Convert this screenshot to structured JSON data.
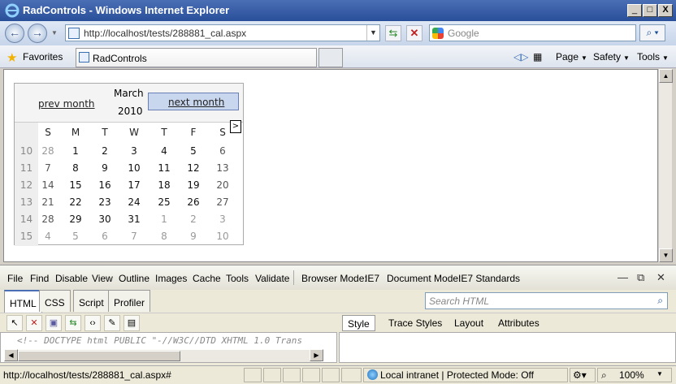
{
  "window": {
    "title": "RadControls - Windows Internet Explorer",
    "minimize": "_",
    "maximize": "□",
    "close": "X"
  },
  "addressbar": {
    "url": "http://localhost/tests/288881_cal.aspx",
    "search_placeholder": "Google"
  },
  "favorites": {
    "label": "Favorites",
    "tab_title": "RadControls"
  },
  "commandbar": {
    "page": "Page",
    "safety": "Safety",
    "tools": "Tools"
  },
  "calendar": {
    "prev_label": "prev month",
    "next_label": "next month",
    "month": "March",
    "year": "2010",
    "tooltip_char": ">",
    "day_headers": [
      "S",
      "M",
      "T",
      "W",
      "T",
      "F",
      "S"
    ],
    "weeks": [
      {
        "num": "10",
        "days": [
          "28",
          "1",
          "2",
          "3",
          "4",
          "5",
          "6"
        ]
      },
      {
        "num": "11",
        "days": [
          "7",
          "8",
          "9",
          "10",
          "11",
          "12",
          "13"
        ]
      },
      {
        "num": "12",
        "days": [
          "14",
          "15",
          "16",
          "17",
          "18",
          "19",
          "20"
        ]
      },
      {
        "num": "13",
        "days": [
          "21",
          "22",
          "23",
          "24",
          "25",
          "26",
          "27"
        ]
      },
      {
        "num": "14",
        "days": [
          "28",
          "29",
          "30",
          "31",
          "1",
          "2",
          "3"
        ]
      },
      {
        "num": "15",
        "days": [
          "4",
          "5",
          "6",
          "7",
          "8",
          "9",
          "10"
        ]
      }
    ]
  },
  "devtools": {
    "menu": [
      "File",
      "Find",
      "Disable",
      "View",
      "Outline",
      "Images",
      "Cache",
      "Tools",
      "Validate"
    ],
    "browser_mode_label": "Browser Mode:",
    "browser_mode_value": "IE7",
    "document_mode_label": "Document Mode:",
    "document_mode_value": "IE7 Standards",
    "tabs": [
      "HTML",
      "CSS",
      "Script",
      "Profiler"
    ],
    "search_placeholder": "Search HTML",
    "right_tabs": [
      "Style",
      "Trace Styles",
      "Layout",
      "Attributes"
    ],
    "source_line": "<!-- DOCTYPE html PUBLIC \"-//W3C//DTD XHTML 1.0 Trans"
  },
  "statusbar": {
    "url": "http://localhost/tests/288881_cal.aspx#",
    "zone": "Local intranet | Protected Mode: Off",
    "zoom": "100%"
  }
}
